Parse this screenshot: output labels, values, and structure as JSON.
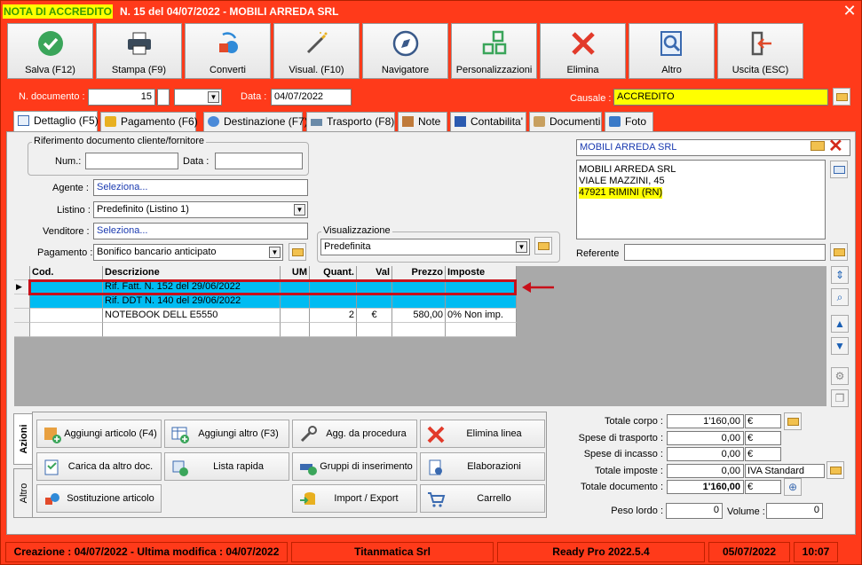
{
  "window": {
    "title_highlight": "NOTA DI ACCREDITO",
    "title_rest": "N. 15 del 04/07/2022 - MOBILI ARREDA SRL",
    "close": "✕"
  },
  "toolbar": [
    "Salva (F12)",
    "Stampa (F9)",
    "Converti",
    "Visual. (F10)",
    "Navigatore",
    "Personalizzazioni",
    "Elimina",
    "Altro",
    "Uscita (ESC)"
  ],
  "header": {
    "ndoc_label": "N. documento :",
    "ndoc_value": "15",
    "data_label": "Data :",
    "data_value": "04/07/2022",
    "causale_label": "Causale :",
    "causale_value": "ACCREDITO"
  },
  "tabs": [
    "Dettaglio (F5)",
    "Pagamento (F6)",
    "Destinazione (F7)",
    "Trasporto (F8)",
    "Note",
    "Contabilita'",
    "Documenti",
    "Foto"
  ],
  "riferimento": {
    "title": "Riferimento documento cliente/fornitore",
    "num_label": "Num.:",
    "data_label": "Data :"
  },
  "fields": {
    "agente_label": "Agente :",
    "agente_value": "Seleziona...",
    "listino_label": "Listino :",
    "listino_value": "Predefinito (Listino 1)",
    "venditore_label": "Venditore :",
    "venditore_value": "Seleziona...",
    "pagamento_label": "Pagamento :",
    "pagamento_value": "Bonifico bancario anticipato",
    "visual_title": "Visualizzazione",
    "visual_value": "Predefinita"
  },
  "cliente": {
    "name": "MOBILI ARREDA SRL",
    "address_lines": [
      "MOBILI ARREDA SRL",
      "VIALE MAZZINI, 45",
      "47921 RIMINI (RN)"
    ],
    "referente_label": "Referente"
  },
  "grid": {
    "columns": [
      "Cod.",
      "Descrizione",
      "UM",
      "Quant.",
      "Val",
      "Prezzo",
      "Imposte"
    ],
    "rows": [
      [
        "",
        "Rif. Fatt. N. 152 del 29/06/2022",
        "",
        "",
        "",
        "",
        ""
      ],
      [
        "",
        "Rif. DDT N. 140 del 29/06/2022",
        "",
        "",
        "",
        "",
        ""
      ],
      [
        "",
        "NOTEBOOK DELL E5550",
        "",
        "2",
        "€",
        "580,00",
        "0% Non imp."
      ],
      [
        "",
        "",
        "",
        "",
        "",
        "",
        ""
      ]
    ]
  },
  "actions": [
    "Aggiungi articolo (F4)",
    "Aggiungi altro (F3)",
    "Agg. da procedura",
    "Elimina linea",
    "Carica da altro doc.",
    "Lista rapida",
    "Gruppi di inserimento",
    "Elaborazioni",
    "Sostituzione articolo",
    "Import / Export",
    "Carrello"
  ],
  "side_tabs": [
    "Azioni",
    "Altro"
  ],
  "totals": {
    "corpo_label": "Totale corpo :",
    "corpo_value": "1'160,00",
    "corpo_unit": "€",
    "trasporto_label": "Spese di trasporto :",
    "trasporto_value": "0,00",
    "trasporto_unit": "€",
    "incasso_label": "Spese di incasso :",
    "incasso_value": "0,00",
    "incasso_unit": "€",
    "imposte_label": "Totale imposte :",
    "imposte_value": "0,00",
    "imposte_unit": "IVA Standard",
    "documento_label": "Totale documento :",
    "documento_value": "1'160,00",
    "documento_unit": "€",
    "peso_label": "Peso lordo :",
    "peso_value": "0",
    "volume_label": "Volume :",
    "volume_value": "0"
  },
  "status": {
    "dates": "Creazione : 04/07/2022 - Ultima modifica : 04/07/2022",
    "company": "Titanmatica Srl",
    "version": "Ready Pro 2022.5.4",
    "date": "05/07/2022",
    "time": "10:07"
  }
}
